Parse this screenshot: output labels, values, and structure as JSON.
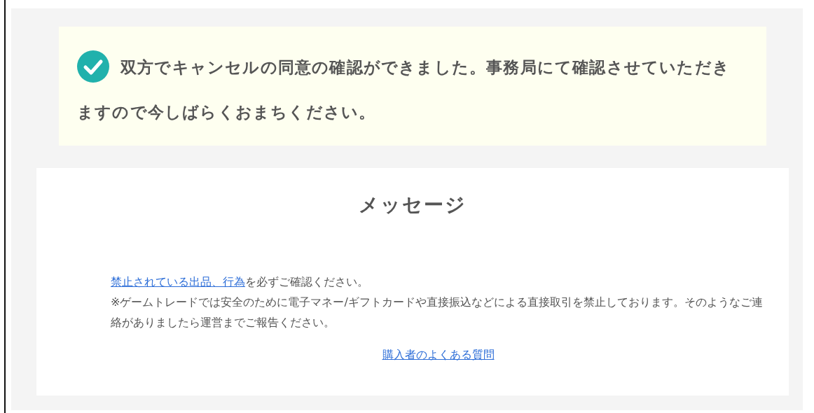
{
  "notice": {
    "text": "双方でキャンセルの同意の確認ができました。事務局にて確認させていただきますので今しばらくおまちください。"
  },
  "message": {
    "title": "メッセージ",
    "rules": {
      "link": "禁止されている出品、行為",
      "text": "を必ずご確認ください。"
    },
    "warning": "※ゲームトレードでは安全のために電子マネー/ギフトカードや直接振込などによる直接取引を禁止しております。そのようなご連絡がありましたら運営までご報告ください。",
    "faq_link": "購入者のよくある質問"
  }
}
